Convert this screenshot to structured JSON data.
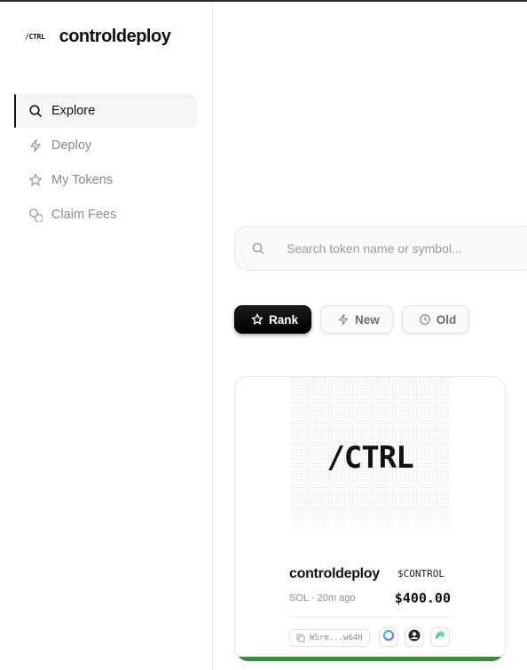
{
  "brand": {
    "mark": "/CTRL",
    "name": "controldeploy"
  },
  "sidebar": {
    "items": [
      {
        "label": "Explore",
        "icon": "search-icon",
        "active": true
      },
      {
        "label": "Deploy",
        "icon": "lightning-icon",
        "active": false
      },
      {
        "label": "My Tokens",
        "icon": "star-icon",
        "active": false
      },
      {
        "label": "Claim Fees",
        "icon": "coins-icon",
        "active": false
      }
    ]
  },
  "search": {
    "placeholder": "Search token name or symbol..."
  },
  "filters": [
    {
      "label": "Rank",
      "icon": "star-icon",
      "active": true
    },
    {
      "label": "New",
      "icon": "lightning-icon",
      "active": false
    },
    {
      "label": "Old",
      "icon": "clock-icon",
      "active": false
    }
  ],
  "tokens": [
    {
      "image_text": "/CTRL",
      "name": "controldeploy",
      "symbol": "$CONTROL",
      "chain": "SOL",
      "separator": "·",
      "age": "20m ago",
      "price": "$400.00",
      "address": "WSrm...w64H",
      "progress": 1.0,
      "colors": {
        "progress": "#3b8a3e"
      }
    }
  ]
}
